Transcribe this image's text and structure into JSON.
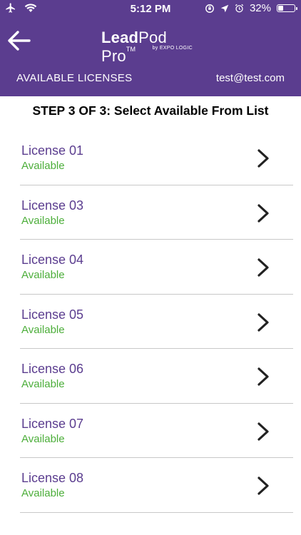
{
  "status_bar": {
    "time": "5:12 PM",
    "battery": "32%"
  },
  "header": {
    "logo_lead": "Lead",
    "logo_pod": "Pod Pro",
    "logo_tm": "TM",
    "logo_by": "by EXPO LOGIC",
    "title": "AVAILABLE LICENSES",
    "email": "test@test.com"
  },
  "step_label": "STEP 3 OF 3: Select Available From List",
  "licenses": [
    {
      "name": "License 01",
      "status": "Available"
    },
    {
      "name": "License 03",
      "status": "Available"
    },
    {
      "name": "License 04",
      "status": "Available"
    },
    {
      "name": "License 05",
      "status": "Available"
    },
    {
      "name": "License 06",
      "status": "Available"
    },
    {
      "name": "License 07",
      "status": "Available"
    },
    {
      "name": "License 08",
      "status": "Available"
    }
  ],
  "colors": {
    "header_bg": "#5b3d8f",
    "name": "#5b3d8f",
    "available": "#4cae3a"
  }
}
